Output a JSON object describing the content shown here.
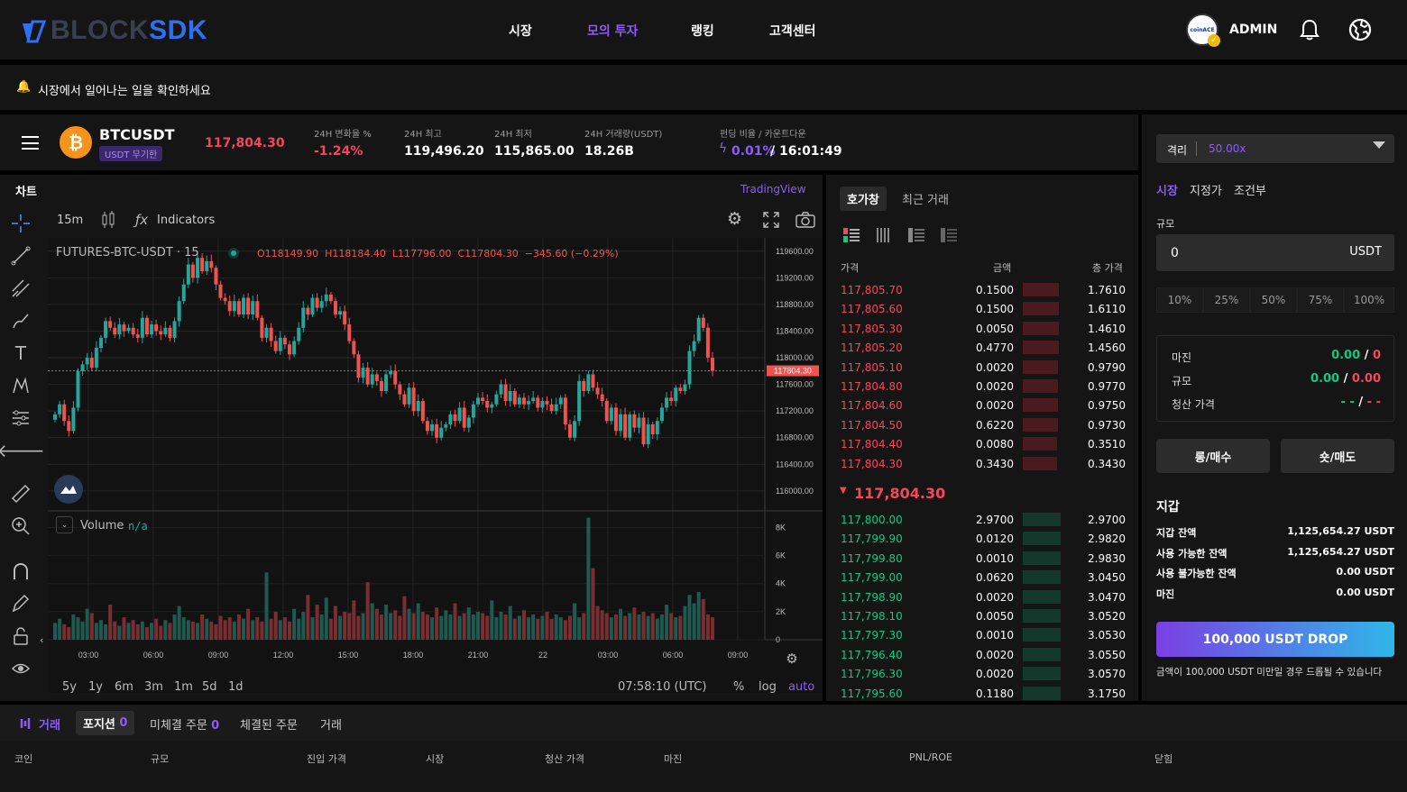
{
  "brand": {
    "part1": "BLOCK",
    "part2": "SDK"
  },
  "nav": {
    "items": [
      "시장",
      "모의 투자",
      "랭킹",
      "고객센터"
    ],
    "active_color": "#8b5cf6"
  },
  "user": {
    "name": "ADMIN",
    "avatar_text": "coinACE"
  },
  "banner": {
    "text": "시장에서 일어나는 일을 확인하세요"
  },
  "ticker": {
    "symbol": "BTCUSDT",
    "contract_badge": "USDT 무기한",
    "last_price": "117,804.30",
    "stats": [
      {
        "label": "24H 변화율 %",
        "value": "-1.24%"
      },
      {
        "label": "24H 최고",
        "value": "119,496.20"
      },
      {
        "label": "24H 최저",
        "value": "115,865.00"
      },
      {
        "label": "24H 거래량(USDT)",
        "value": "18.26B"
      }
    ],
    "funding": {
      "label": "펀딩 비율 / 카운트다운",
      "rate": "0.01%",
      "countdown": "/ 16:01:49"
    }
  },
  "chart_panel": {
    "title": "차트",
    "provider": "TradingView",
    "interval": "15m",
    "indicators_label": "Indicators",
    "series_name": "FUTURES-BTC-USDT · 15",
    "ohlc": {
      "o": "O118149.90",
      "h": "H118184.40",
      "l": "L117796.00",
      "c": "C117804.30",
      "chg": "−345.60 (−0.29%)"
    },
    "volume_label": "Volume",
    "volume_value": "n/a",
    "current_price_tag": "117804.30",
    "ranges": [
      "5y",
      "1y",
      "6m",
      "3m",
      "1m",
      "5d",
      "1d"
    ],
    "clock": "07:58:10 (UTC)",
    "scale_opts": [
      "%",
      "log",
      "auto"
    ]
  },
  "chart_data": {
    "type": "candlestick",
    "price_ticks": [
      "119600.00",
      "119200.00",
      "118800.00",
      "118400.00",
      "118000.00",
      "117600.00",
      "117200.00",
      "116800.00",
      "116400.00",
      "116000.00"
    ],
    "price_range": [
      115700,
      119800
    ],
    "volume_ticks": [
      "8K",
      "6K",
      "4K",
      "2K",
      "0"
    ],
    "volume_range": [
      0,
      8800
    ],
    "time_ticks": [
      "03:00",
      "06:00",
      "09:00",
      "12:00",
      "15:00",
      "18:00",
      "21:00",
      "22",
      "03:00",
      "06:00",
      "09:00"
    ],
    "up_color": "#26a69a",
    "down_color": "#ef5350",
    "close": [
      117150,
      117300,
      117050,
      116900,
      117250,
      117800,
      117900,
      118000,
      117850,
      118150,
      118300,
      118550,
      118450,
      118350,
      118500,
      118400,
      118450,
      118350,
      118300,
      118600,
      118350,
      118500,
      118400,
      118350,
      118450,
      118300,
      118550,
      118850,
      119100,
      119400,
      119200,
      119500,
      119300,
      119450,
      119350,
      119100,
      118900,
      118850,
      118700,
      118850,
      118650,
      118900,
      118650,
      118850,
      118600,
      118300,
      118450,
      118250,
      118100,
      118300,
      118200,
      118050,
      118250,
      118450,
      118750,
      118650,
      118900,
      118750,
      118850,
      118950,
      118850,
      118650,
      118700,
      118500,
      118250,
      118050,
      117700,
      117850,
      117600,
      117750,
      117650,
      117500,
      117750,
      117800,
      117600,
      117450,
      117300,
      117550,
      117200,
      117350,
      117050,
      116900,
      117000,
      116800,
      116950,
      117000,
      117150,
      117050,
      117250,
      116950,
      117100,
      117300,
      117400,
      117350,
      117250,
      117300,
      117450,
      117600,
      117350,
      117500,
      117300,
      117400,
      117300,
      117350,
      117400,
      117250,
      117350,
      117300,
      117200,
      117300,
      117400,
      117000,
      116800,
      117050,
      117650,
      117500,
      117750,
      117550,
      117450,
      117350,
      117050,
      117250,
      116900,
      117150,
      116800,
      117150,
      116950,
      117100,
      116700,
      117000,
      116850,
      117050,
      117250,
      117400,
      117350,
      117550,
      117500,
      117600,
      118100,
      118250,
      118600,
      118450,
      118000,
      117804
    ],
    "volume": [
      1200,
      1500,
      1100,
      900,
      1800,
      1600,
      1300,
      2200,
      1900,
      1200,
      1400,
      1100,
      2500,
      1300,
      1000,
      1600,
      1200,
      1400,
      1100,
      1300,
      900,
      1200,
      1500,
      1000,
      1400,
      1200,
      1800,
      2400,
      1600,
      1400,
      1300,
      1200,
      1800,
      1500,
      1300,
      1100,
      1700,
      1400,
      1600,
      1300,
      1800,
      1500,
      2200,
      1400,
      1600,
      1300,
      4800,
      1500,
      2000,
      1400,
      1600,
      1300,
      2200,
      1500,
      2000,
      3200,
      1600,
      2500,
      1800,
      3000,
      1500,
      2400,
      1700,
      2000,
      1900,
      2800,
      1700,
      1900,
      4100,
      2600,
      2200,
      1800,
      2500,
      1900,
      2100,
      1700,
      3100,
      2200,
      1900,
      2600,
      2000,
      1800,
      1600,
      2300,
      1700,
      2100,
      1800,
      2600,
      1700,
      1900,
      2300,
      1800,
      2000,
      1900,
      1700,
      2800,
      1600,
      2000,
      1800,
      2400,
      1500,
      1700,
      2100,
      1600,
      1800,
      1500,
      1700,
      2000,
      1500,
      1800,
      1600,
      1400,
      1700,
      2600,
      1600,
      1900,
      8700,
      5100,
      2400,
      2100,
      1900,
      1600,
      1800,
      2200,
      1700,
      1900,
      2300,
      1800,
      2000,
      1700,
      1900,
      1500,
      1800,
      2500,
      1900,
      1600,
      1700,
      2400,
      3200,
      2600,
      3400,
      2900,
      1800,
      1600
    ]
  },
  "orderbook": {
    "tabs": [
      "호가창",
      "최근 거래"
    ],
    "headers": [
      "가격",
      "금액",
      "총 가격"
    ],
    "asks": [
      {
        "price": "117,805.70",
        "amount": "0.1500",
        "total": "1.7610",
        "depth": 0.95
      },
      {
        "price": "117,805.60",
        "amount": "0.1500",
        "total": "1.6110",
        "depth": 0.95
      },
      {
        "price": "117,805.30",
        "amount": "0.0050",
        "total": "1.4610",
        "depth": 0.95
      },
      {
        "price": "117,805.20",
        "amount": "0.4770",
        "total": "1.4560",
        "depth": 0.95
      },
      {
        "price": "117,805.10",
        "amount": "0.0020",
        "total": "0.9790",
        "depth": 0.92
      },
      {
        "price": "117,804.80",
        "amount": "0.0020",
        "total": "0.9770",
        "depth": 0.92
      },
      {
        "price": "117,804.60",
        "amount": "0.0020",
        "total": "0.9750",
        "depth": 0.92
      },
      {
        "price": "117,804.50",
        "amount": "0.6220",
        "total": "0.9730",
        "depth": 0.92
      },
      {
        "price": "117,804.40",
        "amount": "0.0080",
        "total": "0.3510",
        "depth": 0.9
      },
      {
        "price": "117,804.30",
        "amount": "0.3430",
        "total": "0.3430",
        "depth": 0.9
      }
    ],
    "mid_price": "117,804.30",
    "bids": [
      {
        "price": "117,800.00",
        "amount": "2.9700",
        "total": "2.9700",
        "depth": 1.0
      },
      {
        "price": "117,799.90",
        "amount": "0.0120",
        "total": "2.9820",
        "depth": 1.0
      },
      {
        "price": "117,799.80",
        "amount": "0.0010",
        "total": "2.9830",
        "depth": 1.0
      },
      {
        "price": "117,799.00",
        "amount": "0.0620",
        "total": "3.0450",
        "depth": 1.0
      },
      {
        "price": "117,798.90",
        "amount": "0.0020",
        "total": "3.0470",
        "depth": 1.0
      },
      {
        "price": "117,798.10",
        "amount": "0.0050",
        "total": "3.0520",
        "depth": 1.0
      },
      {
        "price": "117,797.30",
        "amount": "0.0010",
        "total": "3.0530",
        "depth": 1.0
      },
      {
        "price": "117,796.40",
        "amount": "0.0020",
        "total": "3.0550",
        "depth": 1.0
      },
      {
        "price": "117,796.30",
        "amount": "0.0020",
        "total": "3.0570",
        "depth": 1.0
      },
      {
        "price": "117,795.60",
        "amount": "0.1180",
        "total": "3.1750",
        "depth": 1.0
      }
    ]
  },
  "order_form": {
    "margin_mode": "격리",
    "leverage": "50.00x",
    "order_types": [
      "시장",
      "지정가",
      "조건부"
    ],
    "size_label": "규모",
    "size_value": "0",
    "size_unit": "USDT",
    "percents": [
      "10%",
      "25%",
      "50%",
      "75%",
      "100%"
    ],
    "summary": [
      {
        "label": "마진",
        "value_a": "0.00",
        "value_b": "0"
      },
      {
        "label": "규모",
        "value_a": "0.00",
        "value_b": "0.00"
      },
      {
        "label": "청산 가격",
        "value_a": "- -",
        "value_b": "- -"
      }
    ],
    "long_label": "롱/매수",
    "short_label": "숏/매도"
  },
  "wallet": {
    "title": "지갑",
    "rows": [
      {
        "label": "지갑 잔액",
        "value": "1,125,654.27 USDT"
      },
      {
        "label": "사용 가능한 잔액",
        "value": "1,125,654.27 USDT"
      },
      {
        "label": "사용 불가능한 잔액",
        "value": "0.00 USDT"
      },
      {
        "label": "마진",
        "value": "0.00 USDT"
      }
    ],
    "drop_button": "100,000 USDT DROP",
    "drop_note": "금액이 100,000 USDT 미만일 경우 드롭될 수 있습니다"
  },
  "bottom": {
    "section_label": "거래",
    "tabs": [
      {
        "label": "포지션",
        "count": "0"
      },
      {
        "label": "미체결 주문",
        "count": "0"
      },
      {
        "label": "체결된 주문",
        "count": ""
      },
      {
        "label": "거래",
        "count": ""
      }
    ],
    "columns": [
      "코인",
      "규모",
      "진입 가격",
      "시장",
      "청산 가격",
      "마진",
      "PNL/ROE",
      "닫힘"
    ]
  }
}
